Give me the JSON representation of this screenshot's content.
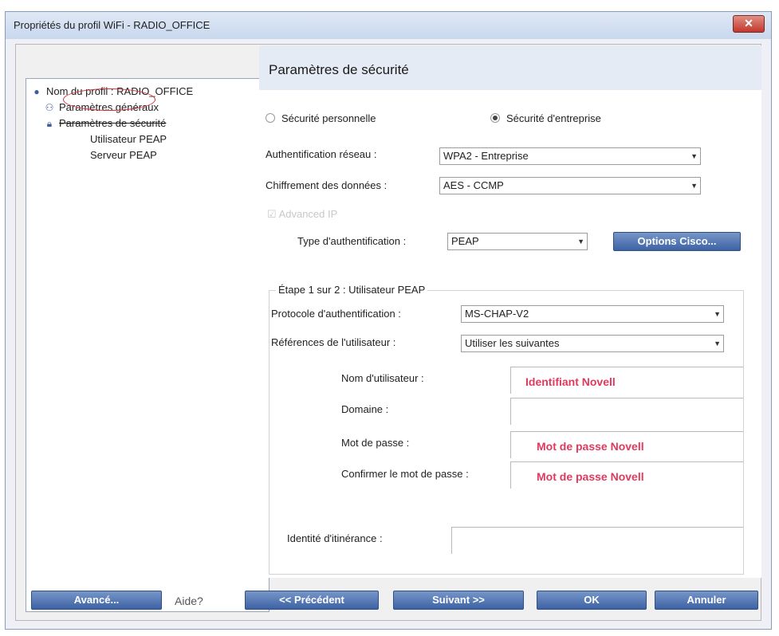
{
  "window": {
    "title": "Propriétés du profil WiFi - RADIO_OFFICE",
    "close_label": "✕"
  },
  "tree": {
    "items": [
      {
        "label": "Nom du profil : RADIO_OFFICE",
        "icon": "globe-icon"
      },
      {
        "label": "Paramètres généraux",
        "icon": "settings-icon"
      },
      {
        "label": "Paramètres de sécurité",
        "icon": "lock-icon"
      },
      {
        "label": "Utilisateur PEAP"
      },
      {
        "label": "Serveur PEAP"
      }
    ]
  },
  "panel": {
    "title": "Paramètres de sécurité",
    "radio_personal": "Sécurité personnelle",
    "radio_enterprise": "Sécurité d'entreprise",
    "selected_radio": "enterprise",
    "auth_label": "Authentification réseau :",
    "auth_value": "WPA2 - Entreprise",
    "cipher_label": "Chiffrement des données :",
    "cipher_value": "AES - CCMP",
    "grayed_checkbox_label": "Advanced IP",
    "auth_type_label": "Type d'authentification :",
    "auth_type_value": "PEAP",
    "cisco_button": "Options Cisco...",
    "step": {
      "legend": "Étape 1 sur 2 : Utilisateur PEAP",
      "protocol_label": "Protocole d'authentification :",
      "protocol_value": "MS-CHAP-V2",
      "creds_label": "Références de l'utilisateur :",
      "creds_value": "Utiliser les suivantes",
      "username_label": "Nom d'utilisateur :",
      "username_value": "Identifiant Novell",
      "domain_label": "Domaine :",
      "domain_value": "",
      "password_label": "Mot de passe :",
      "password_value": "Mot de passe Novell",
      "confirm_label": "Confirmer le mot de passe :",
      "confirm_value": "Mot de passe Novell",
      "roaming_label": "Identité d'itinérance :",
      "roaming_value": ""
    }
  },
  "footer": {
    "advanced": "Avancé...",
    "help": "Aide?",
    "previous": "<< Précédent",
    "next": "Suivant >>",
    "ok": "OK",
    "cancel": "Annuler"
  },
  "colors": {
    "button": "#4a6fb0",
    "annotation": "#e0395e",
    "circle": "#d2323c"
  }
}
